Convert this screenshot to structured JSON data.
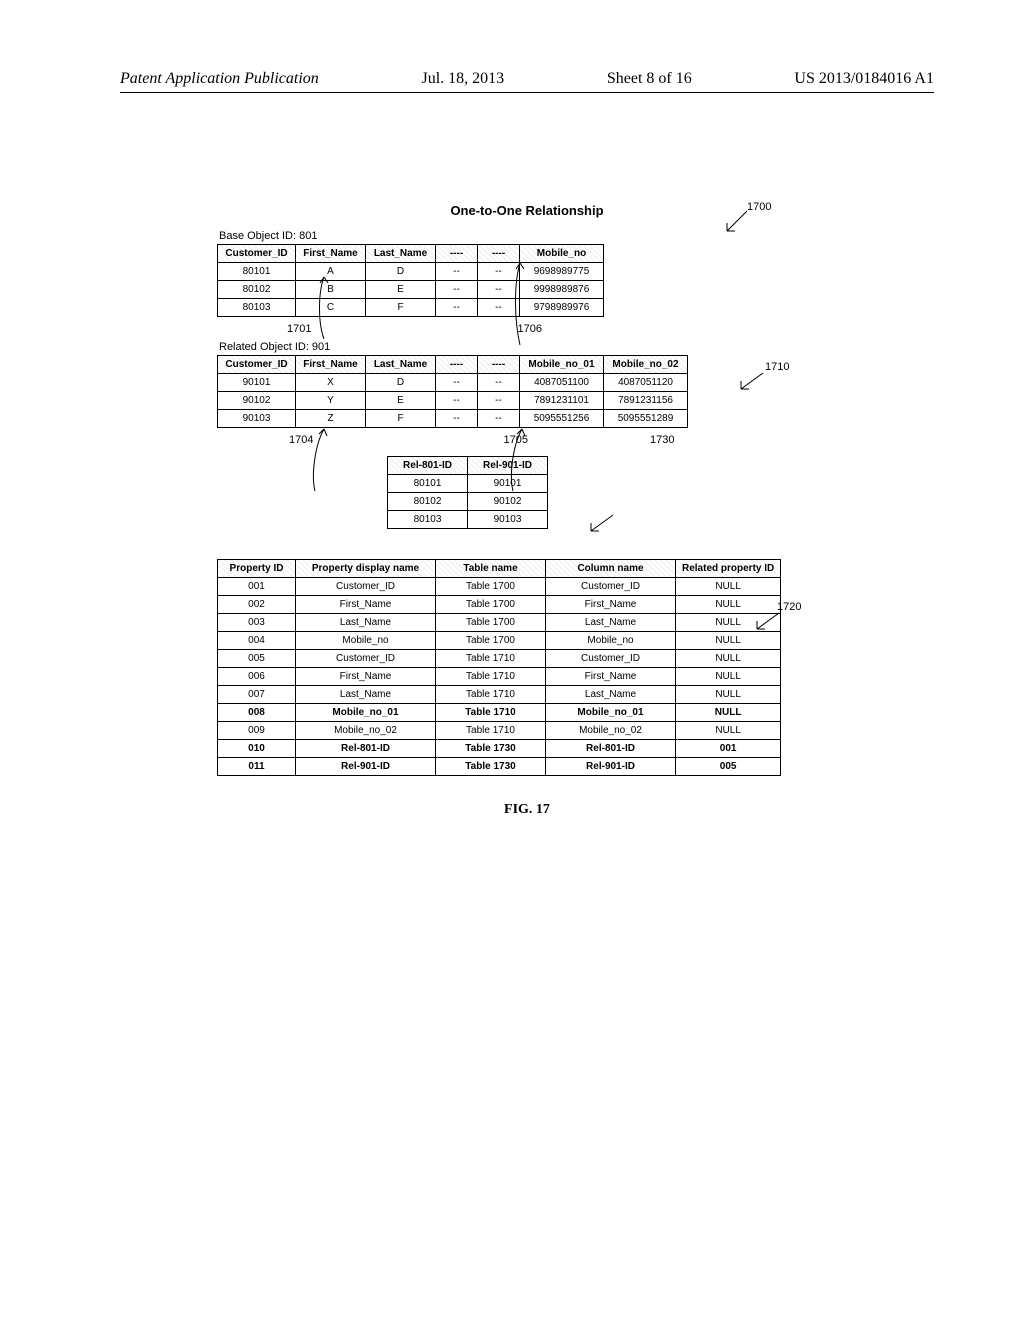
{
  "header": {
    "left": "Patent Application Publication",
    "date": "Jul. 18, 2013",
    "sheet": "Sheet 8 of 16",
    "pub": "US 2013/0184016 A1"
  },
  "fig": {
    "title": "One-to-One Relationship",
    "base_caption": "Base Object ID: 801",
    "related_caption": "Related Object ID: 901",
    "figure_label": "FIG. 17"
  },
  "refs": {
    "r1700": "1700",
    "r1701": "1701",
    "r1704": "1704",
    "r1705": "1705",
    "r1706": "1706",
    "r1710": "1710",
    "r1720": "1720",
    "r1730": "1730"
  },
  "base_headers": [
    "Customer_ID",
    "First_Name",
    "Last_Name",
    "----",
    "----",
    "Mobile_no"
  ],
  "base_rows": [
    [
      "80101",
      "A",
      "D",
      "--",
      "--",
      "9698989775"
    ],
    [
      "80102",
      "B",
      "E",
      "--",
      "--",
      "9998989876"
    ],
    [
      "80103",
      "C",
      "F",
      "--",
      "--",
      "9798989976"
    ]
  ],
  "related_headers": [
    "Customer_ID",
    "First_Name",
    "Last_Name",
    "----",
    "----",
    "Mobile_no_01",
    "Mobile_no_02"
  ],
  "related_rows": [
    [
      "90101",
      "X",
      "D",
      "--",
      "--",
      "4087051100",
      "4087051120"
    ],
    [
      "90102",
      "Y",
      "E",
      "--",
      "--",
      "7891231101",
      "7891231156"
    ],
    [
      "90103",
      "Z",
      "F",
      "--",
      "--",
      "5095551256",
      "5095551289"
    ]
  ],
  "rel_headers": [
    "Rel-801-ID",
    "Rel-901-ID"
  ],
  "rel_rows": [
    [
      "80101",
      "90101"
    ],
    [
      "80102",
      "90102"
    ],
    [
      "80103",
      "90103"
    ]
  ],
  "prop_headers": [
    "Property ID",
    "Property display name",
    "Table name",
    "Column name",
    "Related property ID"
  ],
  "prop_rows": [
    {
      "cells": [
        "001",
        "Customer_ID",
        "Table 1700",
        "Customer_ID",
        "NULL"
      ],
      "bold": false
    },
    {
      "cells": [
        "002",
        "First_Name",
        "Table 1700",
        "First_Name",
        "NULL"
      ],
      "bold": false
    },
    {
      "cells": [
        "003",
        "Last_Name",
        "Table 1700",
        "Last_Name",
        "NULL"
      ],
      "bold": false
    },
    {
      "cells": [
        "004",
        "Mobile_no",
        "Table 1700",
        "Mobile_no",
        "NULL"
      ],
      "bold": false
    },
    {
      "cells": [
        "005",
        "Customer_ID",
        "Table 1710",
        "Customer_ID",
        "NULL"
      ],
      "bold": false
    },
    {
      "cells": [
        "006",
        "First_Name",
        "Table 1710",
        "First_Name",
        "NULL"
      ],
      "bold": false
    },
    {
      "cells": [
        "007",
        "Last_Name",
        "Table 1710",
        "Last_Name",
        "NULL"
      ],
      "bold": false
    },
    {
      "cells": [
        "008",
        "Mobile_no_01",
        "Table 1710",
        "Mobile_no_01",
        "NULL"
      ],
      "bold": true
    },
    {
      "cells": [
        "009",
        "Mobile_no_02",
        "Table 1710",
        "Mobile_no_02",
        "NULL"
      ],
      "bold": false
    },
    {
      "cells": [
        "010",
        "Rel-801-ID",
        "Table 1730",
        "Rel-801-ID",
        "001"
      ],
      "bold": true
    },
    {
      "cells": [
        "011",
        "Rel-901-ID",
        "Table 1730",
        "Rel-901-ID",
        "005"
      ],
      "bold": true
    }
  ]
}
